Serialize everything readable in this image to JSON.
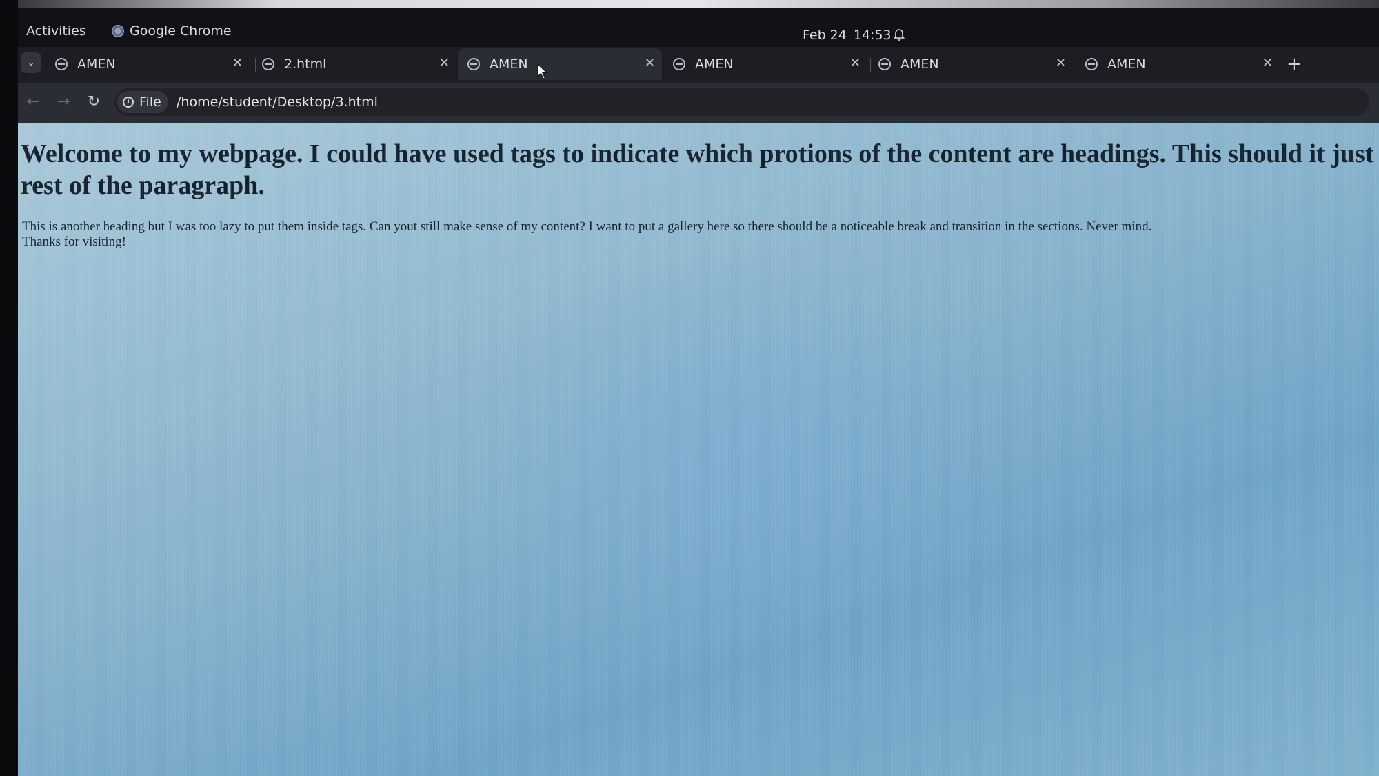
{
  "topbar": {
    "activities_label": "Activities",
    "app_name": "Google Chrome",
    "date": "Feb 24",
    "time": "14:53"
  },
  "tabs": [
    {
      "title": "AMEN",
      "active": false
    },
    {
      "title": "2.html",
      "active": false
    },
    {
      "title": "AMEN",
      "active": true
    },
    {
      "title": "AMEN",
      "active": false
    },
    {
      "title": "AMEN",
      "active": false
    },
    {
      "title": "AMEN",
      "active": false
    }
  ],
  "toolbar": {
    "site_chip_label": "File",
    "url": "/home/student/Desktop/3.html"
  },
  "page": {
    "heading": "Welcome to my webpage. I could have used tags to indicate which protions of the content are headings. This should it just looks like the rest of the paragraph.",
    "paragraph": "This is another heading but I was too lazy to put them inside tags. Can yout still make sense of my content? I want to put a gallery here so there should be a noticeable break and transition in the sections. Never mind. Thanks for visiting!"
  },
  "colors": {
    "page_background": "#86b2cc",
    "text": "#14202c",
    "chrome_dark": "#1d1e24"
  }
}
